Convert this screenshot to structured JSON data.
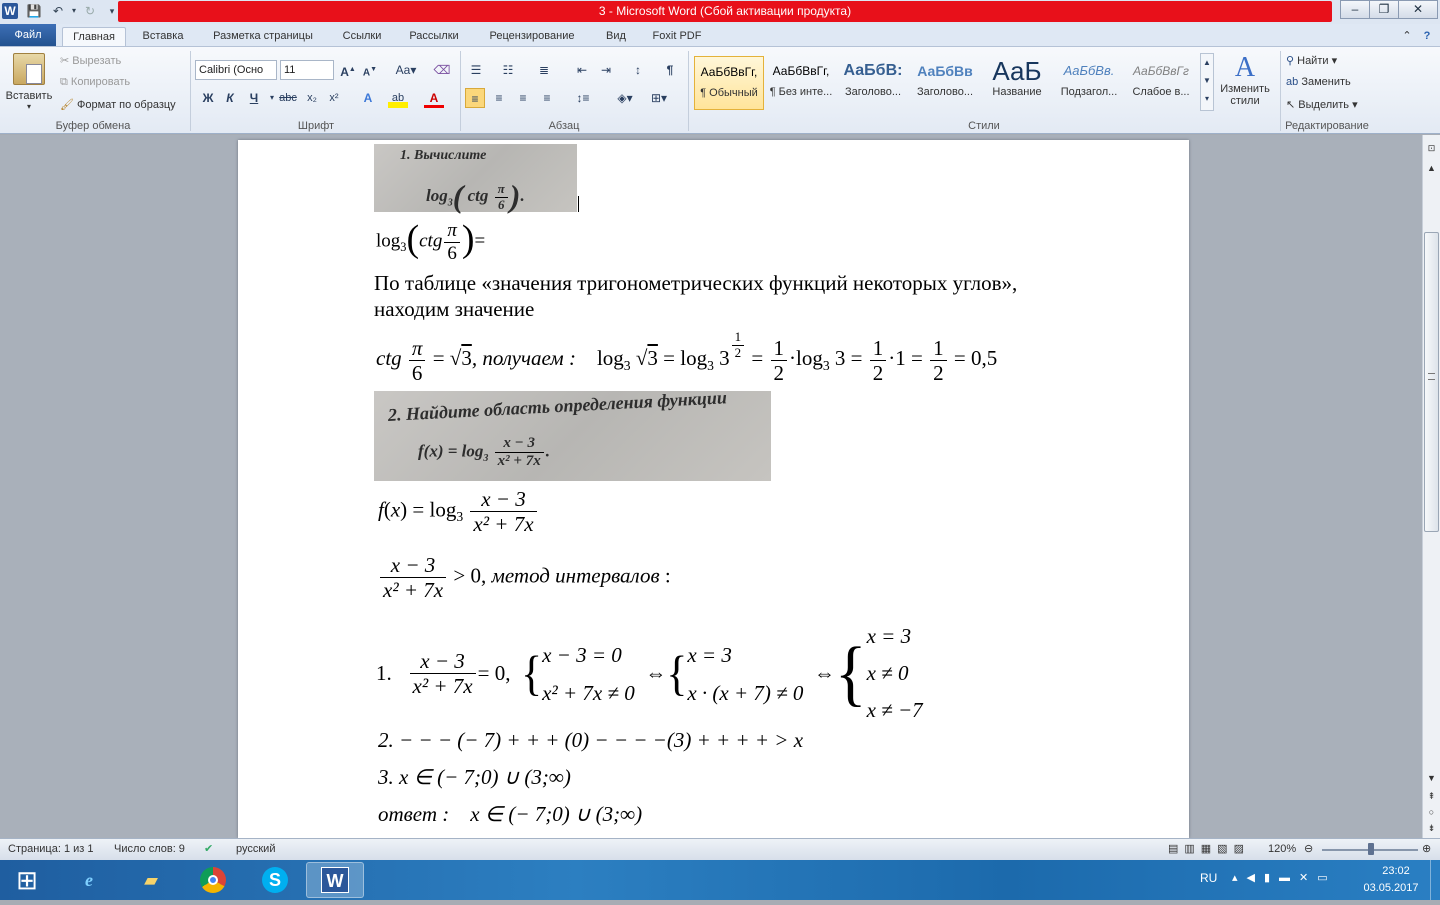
{
  "window": {
    "title": "3  -  Microsoft Word (Сбой активации продукта)"
  },
  "tabs": {
    "file": "Файл",
    "home": "Главная",
    "insert": "Вставка",
    "layout": "Разметка страницы",
    "refs": "Ссылки",
    "mail": "Рассылки",
    "review": "Рецензирование",
    "view": "Вид",
    "foxit": "Foxit PDF"
  },
  "clipboard": {
    "paste": "Вставить",
    "cut": "Вырезать",
    "copy": "Копировать",
    "format": "Формат по образцу",
    "label": "Буфер обмена"
  },
  "font": {
    "name": "Calibri (Осно",
    "size": "11",
    "label": "Шрифт"
  },
  "paragraph": {
    "label": "Абзац"
  },
  "styles": {
    "label": "Стили",
    "items": [
      {
        "sample": "АаБбВвГг,",
        "name": "¶ Обычный"
      },
      {
        "sample": "АаБбВвГг,",
        "name": "¶ Без инте..."
      },
      {
        "sample": "АаБбВ:",
        "name": "Заголово..."
      },
      {
        "sample": "АаБбВв",
        "name": "Заголово..."
      },
      {
        "sample": "АаБ",
        "name": "Название"
      },
      {
        "sample": "АаБбВв.",
        "name": "Подзагол..."
      },
      {
        "sample": "АаБбВвГг",
        "name": "Слабое в..."
      }
    ],
    "change": "Изменить стили"
  },
  "editing": {
    "find": "Найти",
    "replace": "Заменить",
    "select": "Выделить",
    "label": "Редактирование"
  },
  "document": {
    "scan1_line1": "1. Вычислите",
    "scan1_line2": "log",
    "scan1_ctg": "ctg",
    "scan1_num": "π",
    "scan1_den": "6",
    "eq1_log": "log",
    "eq1_ctg": "ctg",
    "eq1_num": "π",
    "eq1_den": "6",
    "eq1_tail": "=",
    "para_text": "По таблице «значения тригонометрических функций некоторых углов», находим значение",
    "eq2_ctg": "ctg",
    "eq2_obtain": ", получаем :",
    "eq2_value": "= 0,5",
    "scan2_line1": "2. Найдите область определения функции",
    "scan2_fx": "f(x)  =  log",
    "scan2_num": "x − 3",
    "scan2_den": "x² + 7x",
    "eq3_num": "x − 3",
    "eq3_den": "x² + 7x",
    "eq4_gt": "> 0,",
    "eq4_method": "метод интервалов",
    "eq4_colon": ":",
    "step1_num": "1.",
    "step1_eq": "= 0,",
    "sys1_a": "x − 3 = 0",
    "sys1_b": "x² + 7x ≠ 0",
    "sys2_a": "x = 3",
    "sys2_b": "x · (x + 7) ≠ 0",
    "sys3_a": "x = 3",
    "sys3_b": "x ≠ 0",
    "sys3_c": "x ≠ −7",
    "step2": "2.    − − − (− 7) + + + (0) − − − −(3) + + + + > x",
    "step3": "3.    x ∈ (− 7;0) ∪ (3;∞)",
    "answer_label": "ответ :",
    "answer": "x ∈ (− 7;0) ∪ (3;∞)"
  },
  "status": {
    "page": "Страница: 1 из 1",
    "words": "Число слов: 9",
    "lang": "русский",
    "zoom": "120%"
  },
  "taskbar": {
    "lang": "RU",
    "time": "23:02",
    "date": "03.05.2017"
  },
  "colors": {
    "accent": "#2b579a",
    "title_red": "#e8101a"
  }
}
